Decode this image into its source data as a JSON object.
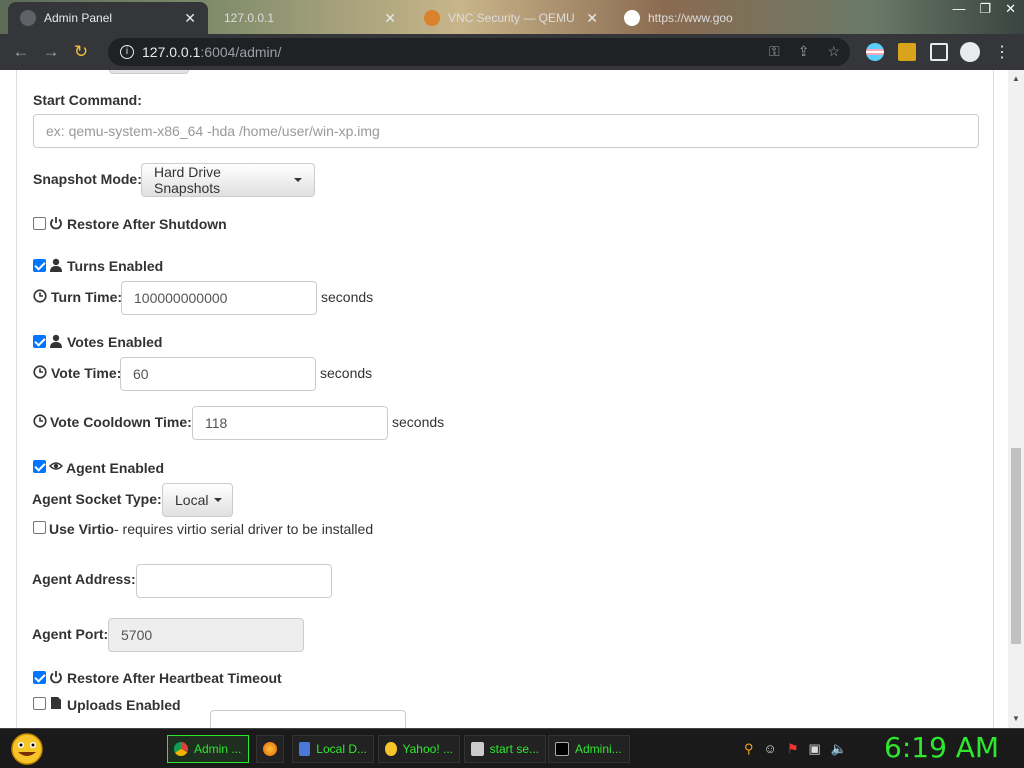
{
  "browser": {
    "tabs": [
      {
        "title": "Admin Panel",
        "active": true
      },
      {
        "title": "127.0.0.1",
        "active": false
      },
      {
        "title": "VNC Security — QEMU",
        "active": false
      },
      {
        "title": "https://www.goo",
        "active": false
      }
    ],
    "url_host": "127.0.0.1",
    "url_rest": ":6004/admin/"
  },
  "form": {
    "start_command_label": "Start Command:",
    "start_command_placeholder": "ex: qemu-system-x86_64 -hda /home/user/win-xp.img",
    "snapshot_mode_label": "Snapshot Mode:",
    "snapshot_mode_value": "Hard Drive Snapshots",
    "restore_after_shutdown_label": "Restore After Shutdown",
    "restore_after_shutdown_checked": false,
    "turns_enabled_label": "Turns Enabled",
    "turns_enabled_checked": true,
    "turn_time_label": "Turn Time:",
    "turn_time_value": "100000000000",
    "turn_time_unit": "seconds",
    "votes_enabled_label": "Votes Enabled",
    "votes_enabled_checked": true,
    "vote_time_label": "Vote Time:",
    "vote_time_value": "60",
    "vote_time_unit": "seconds",
    "vote_cooldown_label": "Vote Cooldown Time:",
    "vote_cooldown_value": "118",
    "vote_cooldown_unit": "seconds",
    "agent_enabled_label": "Agent Enabled",
    "agent_enabled_checked": true,
    "agent_socket_label": "Agent Socket Type:",
    "agent_socket_value": "Local",
    "use_virtio_label": "Use Virtio",
    "use_virtio_note": "- requires virtio serial driver to be installed",
    "use_virtio_checked": false,
    "agent_address_label": "Agent Address:",
    "agent_address_value": "",
    "agent_port_label": "Agent Port:",
    "agent_port_value": "5700",
    "restore_heartbeat_label": "Restore After Heartbeat Timeout",
    "restore_heartbeat_checked": true,
    "uploads_enabled_label": "Uploads Enabled",
    "uploads_enabled_checked": false
  },
  "taskbar": {
    "items": [
      {
        "label": "Admin ...",
        "active": true
      },
      {
        "label": "",
        "active": false
      },
      {
        "label": "Local D...",
        "active": false
      },
      {
        "label": "Yahoo! ...",
        "active": false
      },
      {
        "label": "start se...",
        "active": false
      },
      {
        "label": "Admini...",
        "active": false
      }
    ],
    "clock": "6:19 AM"
  },
  "colors": {
    "accent_check": "#0075ff",
    "taskbar_text": "#2ee82e",
    "browser_dark": "#35363a"
  }
}
